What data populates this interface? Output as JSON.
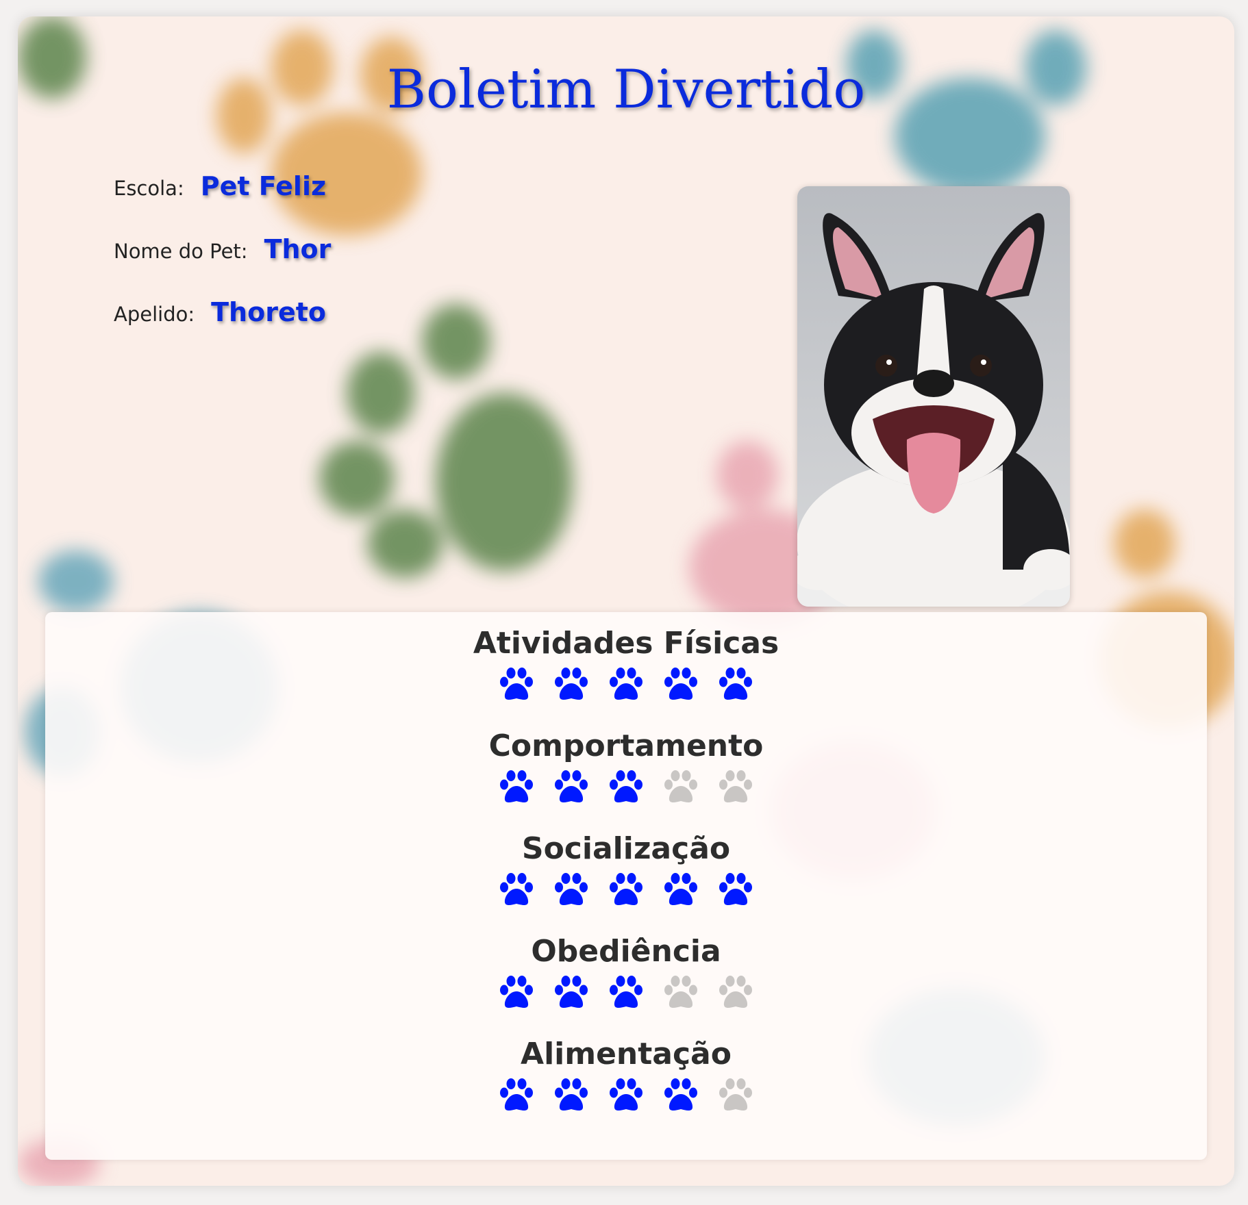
{
  "title": "Boletim Divertido",
  "info": {
    "school_label": "Escola:",
    "school_value": "Pet Feliz",
    "pet_name_label": "Nome do Pet:",
    "pet_name_value": "Thor",
    "nickname_label": "Apelido:",
    "nickname_value": "Thoreto"
  },
  "photo": {
    "subject": "french-bulldog-photo"
  },
  "ratings": {
    "max": 5,
    "items": [
      {
        "label": "Atividades Físicas",
        "score": 5
      },
      {
        "label": "Comportamento",
        "score": 3
      },
      {
        "label": "Socialização",
        "score": 5
      },
      {
        "label": "Obediência",
        "score": 3
      },
      {
        "label": "Alimentação",
        "score": 4
      }
    ]
  },
  "colors": {
    "accent": "#0a2bdc",
    "paw_filled": "#0019ff",
    "paw_empty": "#c9c6c4",
    "text_dark": "#2d2d2d"
  },
  "icons": {
    "rating": "paw-icon"
  }
}
